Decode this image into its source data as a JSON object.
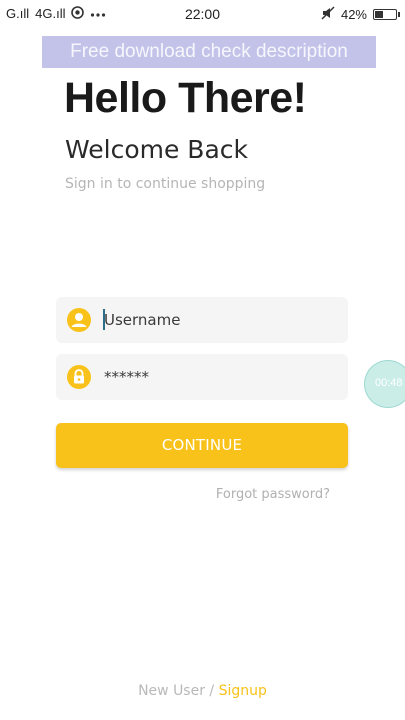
{
  "status_bar": {
    "signal_1": "G.ıll",
    "signal_2": "4G.ıll",
    "time": "22:00",
    "battery_percent": "42%",
    "battery_level": 0.42,
    "icons": [
      "signal-icon",
      "chrome-icon",
      "more-icon",
      "mute-icon",
      "battery-icon"
    ]
  },
  "watermark": "Free download check description",
  "header": {
    "title": "Hello There!",
    "subtitle": "Welcome Back",
    "tagline": "Sign in to continue shopping"
  },
  "form": {
    "username": {
      "placeholder": "Username",
      "value": "",
      "icon": "user-icon"
    },
    "password": {
      "placeholder": "******",
      "value": "",
      "icon": "lock-icon"
    },
    "continue_label": "CONTINUE",
    "forgot_label": "Forgot password?"
  },
  "timer_bubble": "00:48",
  "footer": {
    "new_user": "New User",
    "separator": " / ",
    "signup": "Signup"
  },
  "colors": {
    "accent": "#f8c21a",
    "field_bg": "#f5f5f5",
    "muted_text": "#b5b5b5"
  }
}
